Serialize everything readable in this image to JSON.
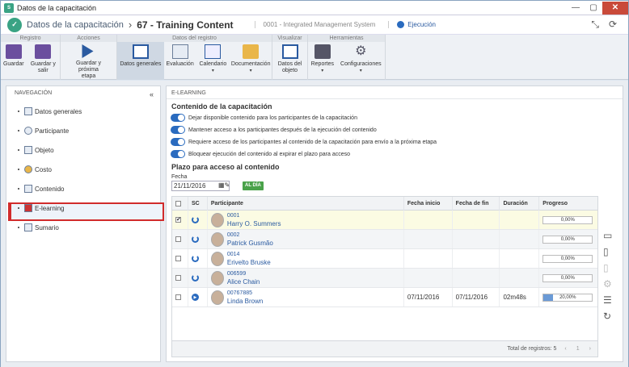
{
  "window": {
    "title": "Datos de la capacitación",
    "minimize": "—",
    "maximize": "▢",
    "close": "✕"
  },
  "header": {
    "app_name": "Datos de la capacitación",
    "record_title": "67 - Training Content",
    "system": "0001 - Integrated Management System",
    "status": "Ejecución",
    "separator": "›"
  },
  "toolbar": {
    "groups": {
      "registro": "Registro",
      "acciones": "Acciones",
      "datos": "Datos del registro",
      "visualizar": "Visualizar",
      "herramientas": "Herramientas"
    },
    "guardar": "Guardar",
    "guardar_salir": "Guardar y salir",
    "guardar_prox": "Guardar y próxima etapa",
    "datos_generales": "Datos generales",
    "evaluacion": "Evaluación",
    "calendario": "Calendario",
    "documentacion": "Documentación",
    "datos_objeto": "Datos del objeto",
    "reportes": "Reportes",
    "configuraciones": "Configuraciones"
  },
  "nav": {
    "title": "NAVEGACIÓN",
    "collapse": "«",
    "items": [
      {
        "label": "Datos generales"
      },
      {
        "label": "Participante"
      },
      {
        "label": "Objeto"
      },
      {
        "label": "Costo"
      },
      {
        "label": "Contenido"
      },
      {
        "label": "E-learning"
      },
      {
        "label": "Sumario"
      }
    ]
  },
  "main": {
    "section_header": "E-LEARNING",
    "content_title": "Contenido de la capacitación",
    "toggles": [
      "Dejar disponible contenido para los participantes de la capacitación",
      "Mantener acceso a los participantes después de la ejecución del contenido",
      "Requiere acceso de los participantes al contenido de la capacitación para envío a la próxima etapa",
      "Bloquear ejecución del contenido al expirar el plazo para acceso"
    ],
    "plazo_title": "Plazo para acceso al contenido",
    "fecha_label": "Fecha",
    "fecha_value": "21/11/2016",
    "aldia": "AL DÍA"
  },
  "grid": {
    "headers": {
      "sc": "SC",
      "participante": "Participante",
      "fecha_inicio": "Fecha inicio",
      "fecha_fin": "Fecha de fin",
      "duracion": "Duración",
      "progreso": "Progreso"
    },
    "rows": [
      {
        "id": "0001",
        "name": "Harry O. Summers",
        "start": "",
        "end": "",
        "dur": "",
        "progress": 0,
        "progress_text": "0,00%",
        "checked": "✔",
        "icon": "power"
      },
      {
        "id": "0002",
        "name": "Patrick Gusmão",
        "start": "",
        "end": "",
        "dur": "",
        "progress": 0,
        "progress_text": "0,00%",
        "checked": "",
        "icon": "power"
      },
      {
        "id": "0014",
        "name": "Erivelto Bruske",
        "start": "",
        "end": "",
        "dur": "",
        "progress": 0,
        "progress_text": "0,00%",
        "checked": "",
        "icon": "power"
      },
      {
        "id": "006599",
        "name": "Alice Chain",
        "start": "",
        "end": "",
        "dur": "",
        "progress": 0,
        "progress_text": "0,00%",
        "checked": "",
        "icon": "power"
      },
      {
        "id": "00767885",
        "name": "Linda Brown",
        "start": "07/11/2016",
        "end": "07/11/2016",
        "dur": "02m48s",
        "progress": 20,
        "progress_text": "20,00%",
        "checked": "",
        "icon": "play"
      }
    ],
    "footer": "Total de registros: 5",
    "pager_prev": "‹",
    "pager_page": "1",
    "pager_next": "›"
  }
}
